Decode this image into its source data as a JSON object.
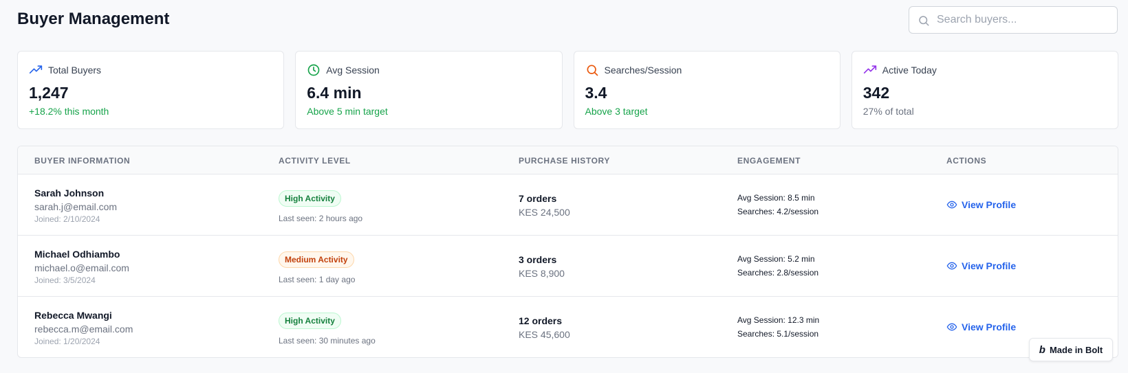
{
  "header": {
    "title": "Buyer Management",
    "search_placeholder": "Search buyers..."
  },
  "stats": [
    {
      "icon": "trending-up-icon",
      "label": "Total Buyers",
      "value": "1,247",
      "sub": "+18.2% this month",
      "icon_color": "#2563eb",
      "sub_color": "green"
    },
    {
      "icon": "clock-icon",
      "label": "Avg Session",
      "value": "6.4 min",
      "sub": "Above 5 min target",
      "icon_color": "#16a34a",
      "sub_color": "green"
    },
    {
      "icon": "search-icon",
      "label": "Searches/Session",
      "value": "3.4",
      "sub": "Above 3 target",
      "icon_color": "#ea580c",
      "sub_color": "green"
    },
    {
      "icon": "trending-up-icon",
      "label": "Active Today",
      "value": "342",
      "sub": "27% of total",
      "icon_color": "#9333ea",
      "sub_color": "gray"
    }
  ],
  "table": {
    "headers": [
      "BUYER INFORMATION",
      "ACTIVITY LEVEL",
      "PURCHASE HISTORY",
      "ENGAGEMENT",
      "ACTIONS"
    ],
    "rows": [
      {
        "name": "Sarah Johnson",
        "email": "sarah.j@email.com",
        "joined": "Joined: 2/10/2024",
        "activity": "High Activity",
        "activity_level": "high",
        "last_seen": "Last seen: 2 hours ago",
        "orders": "7 orders",
        "amount": "KES 24,500",
        "avg_session": "Avg Session: 8.5 min",
        "searches": "Searches: 4.2/session",
        "action": "View Profile"
      },
      {
        "name": "Michael Odhiambo",
        "email": "michael.o@email.com",
        "joined": "Joined: 3/5/2024",
        "activity": "Medium Activity",
        "activity_level": "medium",
        "last_seen": "Last seen: 1 day ago",
        "orders": "3 orders",
        "amount": "KES 8,900",
        "avg_session": "Avg Session: 5.2 min",
        "searches": "Searches: 2.8/session",
        "action": "View Profile"
      },
      {
        "name": "Rebecca Mwangi",
        "email": "rebecca.m@email.com",
        "joined": "Joined: 1/20/2024",
        "activity": "High Activity",
        "activity_level": "high",
        "last_seen": "Last seen: 30 minutes ago",
        "orders": "12 orders",
        "amount": "KES 45,600",
        "avg_session": "Avg Session: 12.3 min",
        "searches": "Searches: 5.1/session",
        "action": "View Profile"
      }
    ]
  },
  "badge": {
    "label": "Made in Bolt"
  },
  "colors": {
    "accent": "#2563eb",
    "positive": "#16a34a"
  }
}
